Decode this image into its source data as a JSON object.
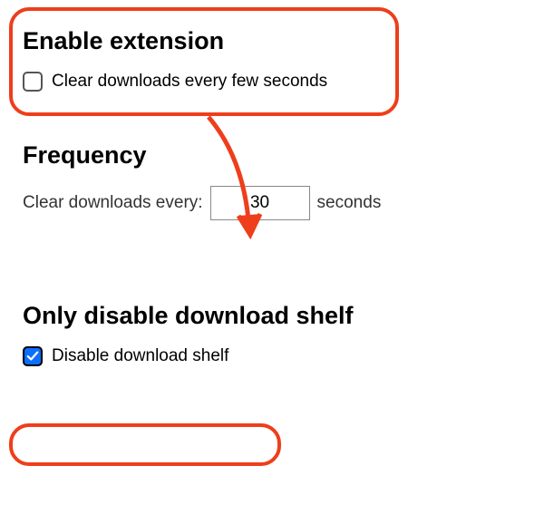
{
  "enable": {
    "heading": "Enable extension",
    "checkbox_label": "Clear downloads every few seconds",
    "checkbox_checked": false
  },
  "frequency": {
    "heading": "Frequency",
    "label_prefix": "Clear downloads every:",
    "value": "30",
    "label_suffix": "seconds"
  },
  "shelf": {
    "heading": "Only disable download shelf",
    "checkbox_label": "Disable download shelf",
    "checkbox_checked": true
  },
  "annotation": {
    "color": "#ee3e1c"
  }
}
